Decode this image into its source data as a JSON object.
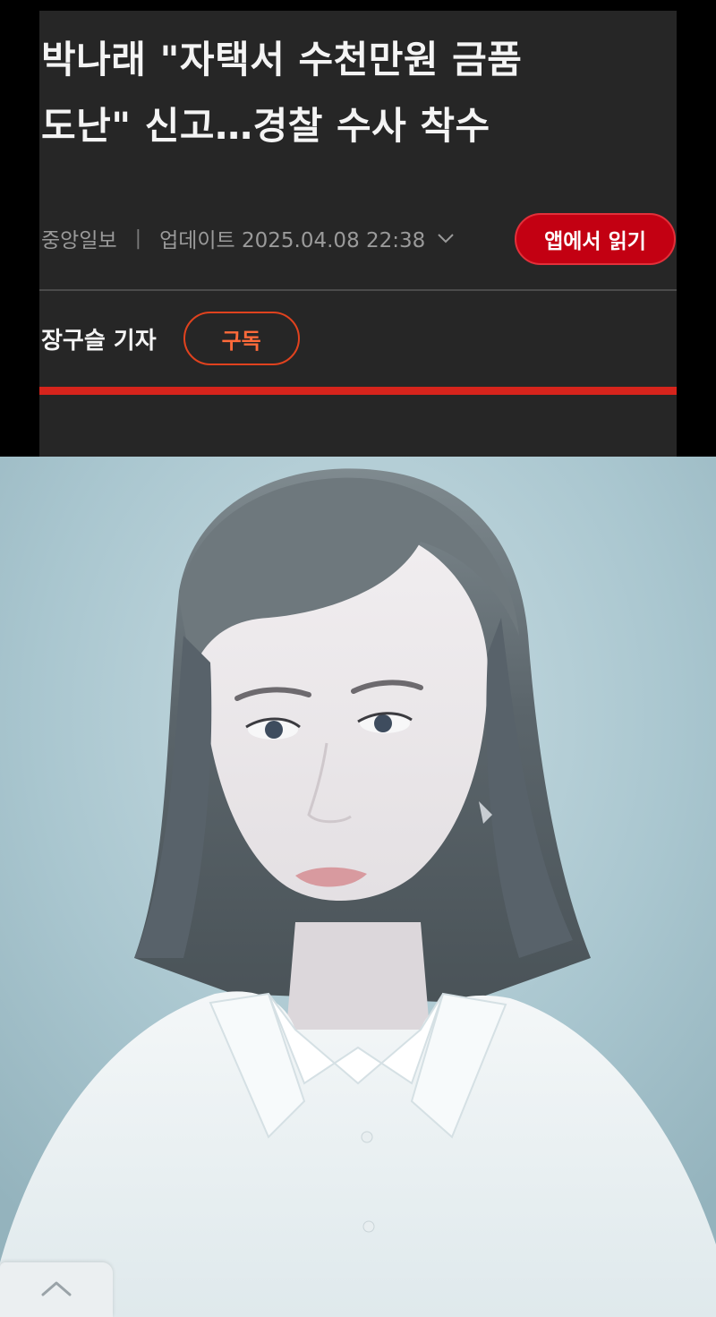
{
  "article": {
    "headline_line1": "박나래 \"자택서 수천만원 금품",
    "headline_line2": "도난\" 신고…경찰 수사 착수",
    "publisher": "중앙일보",
    "separator": "|",
    "updated": "업데이트 2025.04.08 22:38",
    "expand_icon": "chevron-down-icon",
    "app_button_label": "앱에서 읽기",
    "author": "장구슬 기자",
    "subscribe_label": "구독"
  },
  "photo": {
    "subject": "portrait-photo"
  },
  "scroll_top": {
    "icon": "chevron-up-icon"
  },
  "colors": {
    "panel_bg": "#262626",
    "accent_red": "#c30012",
    "subscribe_orange": "#ff6a3a",
    "red_bar": "#d6241c"
  }
}
